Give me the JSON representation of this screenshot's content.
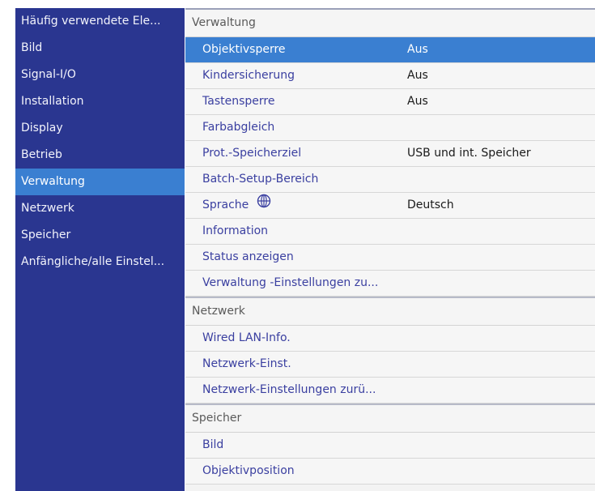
{
  "sidebar": {
    "items": [
      {
        "label": "Häufig verwendete Ele...",
        "selected": false
      },
      {
        "label": "Bild",
        "selected": false
      },
      {
        "label": "Signal-I/O",
        "selected": false
      },
      {
        "label": "Installation",
        "selected": false
      },
      {
        "label": "Display",
        "selected": false
      },
      {
        "label": "Betrieb",
        "selected": false
      },
      {
        "label": "Verwaltung",
        "selected": true
      },
      {
        "label": "Netzwerk",
        "selected": false
      },
      {
        "label": "Speicher",
        "selected": false
      },
      {
        "label": "Anfängliche/alle Einstel...",
        "selected": false
      }
    ]
  },
  "panel": {
    "verwaltung": {
      "header": "Verwaltung",
      "rows": [
        {
          "label": "Objektivsperre",
          "value": "Aus"
        },
        {
          "label": "Kindersicherung",
          "value": "Aus"
        },
        {
          "label": "Tastensperre",
          "value": "Aus"
        },
        {
          "label": "Farbabgleich",
          "value": ""
        },
        {
          "label": "Prot.-Speicherziel",
          "value": "USB und int. Speicher"
        },
        {
          "label": "Batch-Setup-Bereich",
          "value": ""
        },
        {
          "label": "Sprache",
          "value": "Deutsch"
        },
        {
          "label": "Information",
          "value": ""
        },
        {
          "label": "Status anzeigen",
          "value": ""
        },
        {
          "label": "Verwaltung -Einstellungen zu...",
          "value": ""
        }
      ]
    },
    "netzwerk": {
      "header": "Netzwerk",
      "rows": [
        {
          "label": "Wired LAN-Info."
        },
        {
          "label": "Netzwerk-Einst."
        },
        {
          "label": "Netzwerk-Einstellungen zurü..."
        }
      ]
    },
    "speicher": {
      "header": "Speicher",
      "rows": [
        {
          "label": "Bild"
        },
        {
          "label": "Objektivposition"
        }
      ]
    }
  },
  "icons": {
    "language": "globe-icon"
  },
  "colors": {
    "sidebar_bg": "#2a3690",
    "selection": "#3a7fd1",
    "item_text": "#3a3fa0"
  }
}
